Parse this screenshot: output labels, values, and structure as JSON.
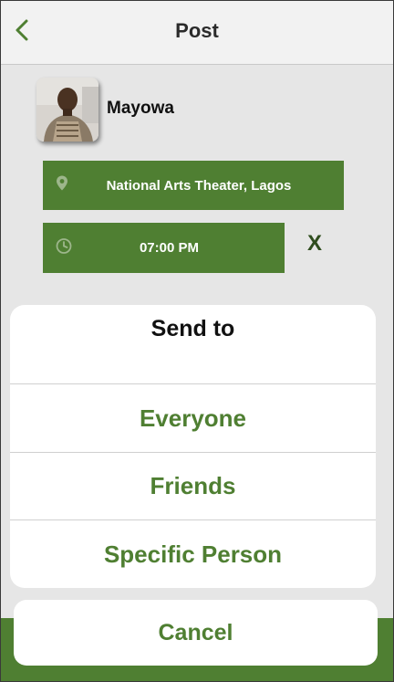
{
  "header": {
    "title": "Post",
    "back_icon": "chevron-left-icon"
  },
  "user": {
    "name": "Mayowa"
  },
  "location": {
    "icon": "map-pin-icon",
    "value": "National Arts Theater, Lagos"
  },
  "time": {
    "icon": "clock-icon",
    "value": "07:00 PM",
    "clear_label": "X"
  },
  "action_sheet": {
    "title": "Send to",
    "options": [
      {
        "label": "Everyone"
      },
      {
        "label": "Friends"
      },
      {
        "label": "Specific Person"
      }
    ],
    "cancel_label": "Cancel"
  },
  "colors": {
    "accent_green": "#4f7f32",
    "header_bg": "#f2f2f2",
    "content_bg": "#e6e6e6"
  }
}
